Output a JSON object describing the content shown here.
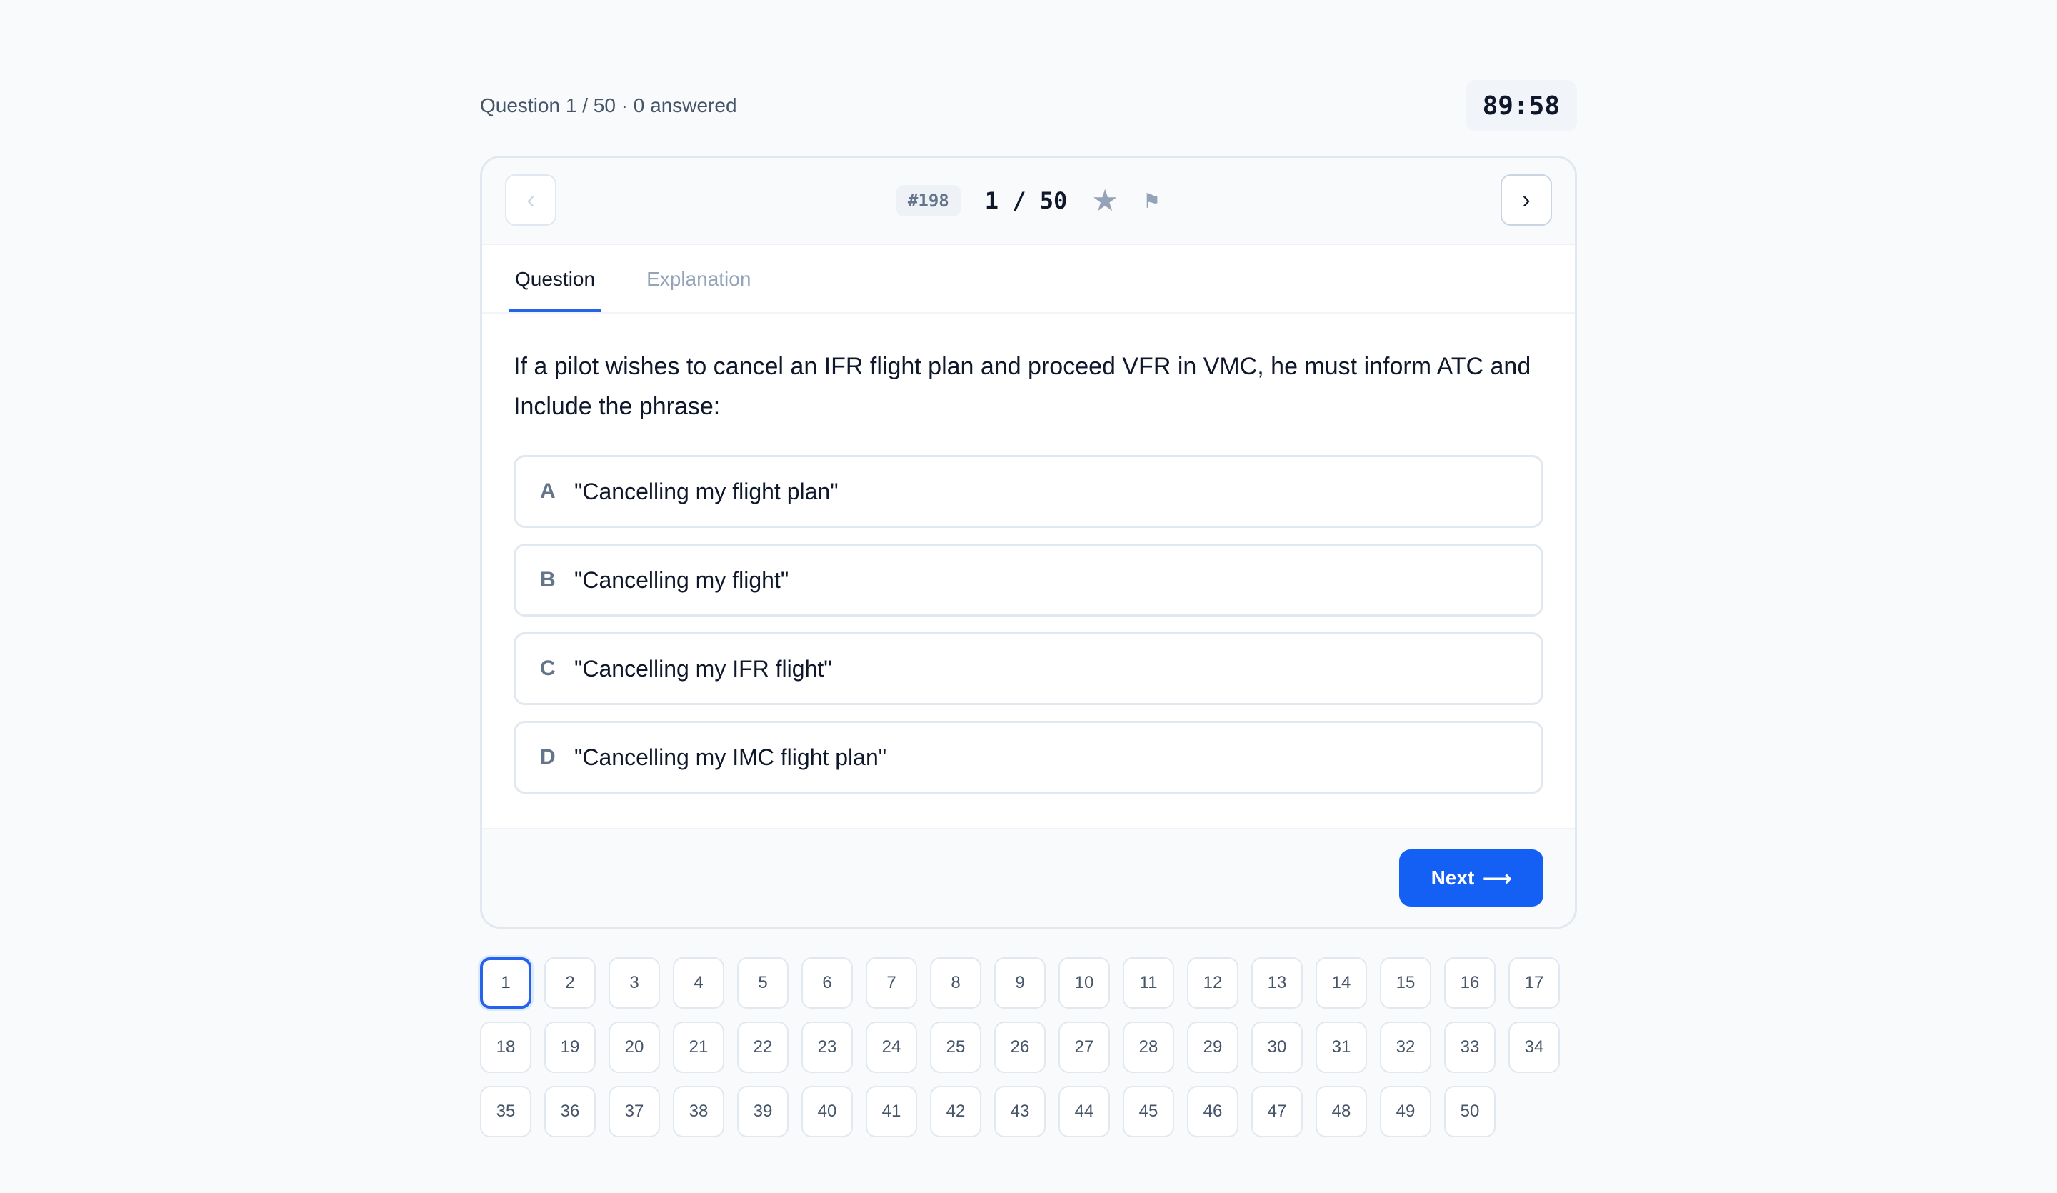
{
  "status": {
    "progress_text": "Question 1 / 50 · 0 answered",
    "timer": "89:58"
  },
  "header": {
    "prev_icon": "‹",
    "next_icon": "›",
    "question_id": "#198",
    "counter": "1 / 50",
    "star_icon": "★",
    "flag_icon": "⚑"
  },
  "tabs": [
    {
      "label": "Question",
      "active": true
    },
    {
      "label": "Explanation",
      "active": false
    }
  ],
  "question": {
    "text": "If a pilot wishes to cancel an IFR flight plan and proceed VFR in VMC, he must inform ATC and Include the phrase:",
    "options": [
      {
        "letter": "A",
        "text": "\"Cancelling my flight plan\""
      },
      {
        "letter": "B",
        "text": "\"Cancelling my flight\""
      },
      {
        "letter": "C",
        "text": "\"Cancelling my IFR flight\""
      },
      {
        "letter": "D",
        "text": "\"Cancelling my IMC flight plan\""
      }
    ]
  },
  "footer": {
    "next_label": "Next",
    "next_arrow": "⟶"
  },
  "navigator": {
    "current": 1,
    "items": [
      "1",
      "2",
      "3",
      "4",
      "5",
      "6",
      "7",
      "8",
      "9",
      "10",
      "11",
      "12",
      "13",
      "14",
      "15",
      "16",
      "17",
      "18",
      "19",
      "20",
      "21",
      "22",
      "23",
      "24",
      "25",
      "26",
      "27",
      "28",
      "29",
      "30",
      "31",
      "32",
      "33",
      "34",
      "35",
      "36",
      "37",
      "38",
      "39",
      "40",
      "41",
      "42",
      "43",
      "44",
      "45",
      "46",
      "47",
      "48",
      "49",
      "50"
    ]
  },
  "colors": {
    "accent": "#1560f4",
    "background": "#f8fafc"
  }
}
